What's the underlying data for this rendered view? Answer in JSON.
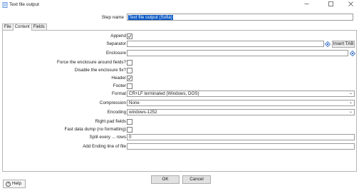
{
  "window": {
    "title": "Text file output",
    "minimize_icon": "minimize-icon",
    "maximize_icon": "maximize-icon",
    "close_icon": "close-icon"
  },
  "step": {
    "label": "Step name",
    "value": "Text file output (Sofia)"
  },
  "tabs": [
    {
      "label": "File"
    },
    {
      "label": "Content"
    },
    {
      "label": "Fields"
    }
  ],
  "content": {
    "append_label": "Append",
    "append_checked": true,
    "separator_label": "Separator",
    "separator_value": "",
    "insert_tab_label": "Insert TAB",
    "enclosure_label": "Enclosure",
    "enclosure_value": "",
    "force_enclosure_label": "Force the enclosure around fields?",
    "force_enclosure_checked": false,
    "disable_enclosure_label": "Disable the enclosure fix?",
    "disable_enclosure_checked": false,
    "header_label": "Header",
    "header_checked": true,
    "footer_label": "Footer",
    "footer_checked": false,
    "format_label": "Format",
    "format_value": "CR+LF terminated (Windows, DOS)",
    "compression_label": "Compression",
    "compression_value": "None",
    "encoding_label": "Encoding",
    "encoding_value": "windows-1252",
    "right_pad_label": "Right pad fields",
    "right_pad_checked": false,
    "fast_dump_label": "Fast data dump (no formatting)",
    "fast_dump_checked": false,
    "split_label": "Split every ... rows",
    "split_value": "0",
    "ending_line_label": "Add Ending line of file",
    "ending_line_value": ""
  },
  "buttons": {
    "ok": "OK",
    "cancel": "Cancel",
    "help": "Help"
  },
  "colors": {
    "selection": "#0a58c4",
    "variable_icon": "#1f5fbf"
  }
}
